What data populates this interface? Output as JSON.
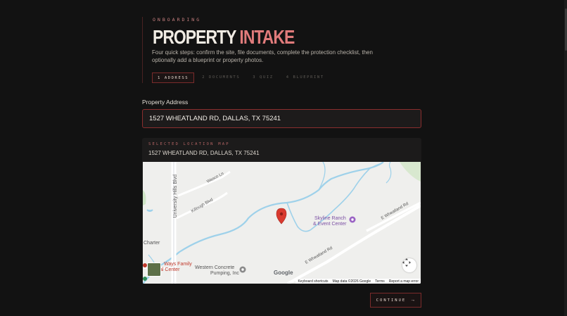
{
  "hero": {
    "eyebrow": "ONBOARDING",
    "title_part1": "PROPERTY",
    "title_part2": "INTAKE",
    "description": "Four quick steps: confirm the site, file documents, complete the protection checklist, then optionally add a blueprint or property photos."
  },
  "steps": [
    {
      "label": "1 ADDRESS",
      "active": true
    },
    {
      "label": "2 DOCUMENTS",
      "active": false
    },
    {
      "label": "3 QUIZ",
      "active": false
    },
    {
      "label": "4 BLUEPRINT",
      "active": false
    }
  ],
  "form": {
    "address_label": "Property Address",
    "address_value": "1527 WHEATLAND RD, DALLAS, TX 75241"
  },
  "map_card": {
    "eyebrow": "SELECTED LOCATION MAP",
    "location": "1527 WHEATLAND RD, DALLAS, TX 75241",
    "map_labels": {
      "road1": "University Hills Blvd",
      "road2": "Wasco Ln",
      "road3": "Killough Blvd",
      "road4": "E Wheatland Rd",
      "road5": "E Wheatland Rd",
      "poi1_line1": "Skyline Ranch",
      "poi1_line2": "& Event Center",
      "poi2_line1": "Western Concrete",
      "poi2_line2": "Pumping, Inc",
      "poi3_line1": "Ways Family",
      "poi3_line2": "al Center",
      "charter": "Charter",
      "google": "Google"
    },
    "attribution": {
      "shortcuts": "Keyboard shortcuts",
      "map_data": "Map data ©2026 Google",
      "terms": "Terms",
      "report": "Report a map error"
    }
  },
  "actions": {
    "continue_label": "CONTINUE",
    "continue_arrow": "→"
  },
  "colors": {
    "accent": "#e07b7b",
    "border_accent": "#8a2e2e",
    "background": "#121212"
  }
}
